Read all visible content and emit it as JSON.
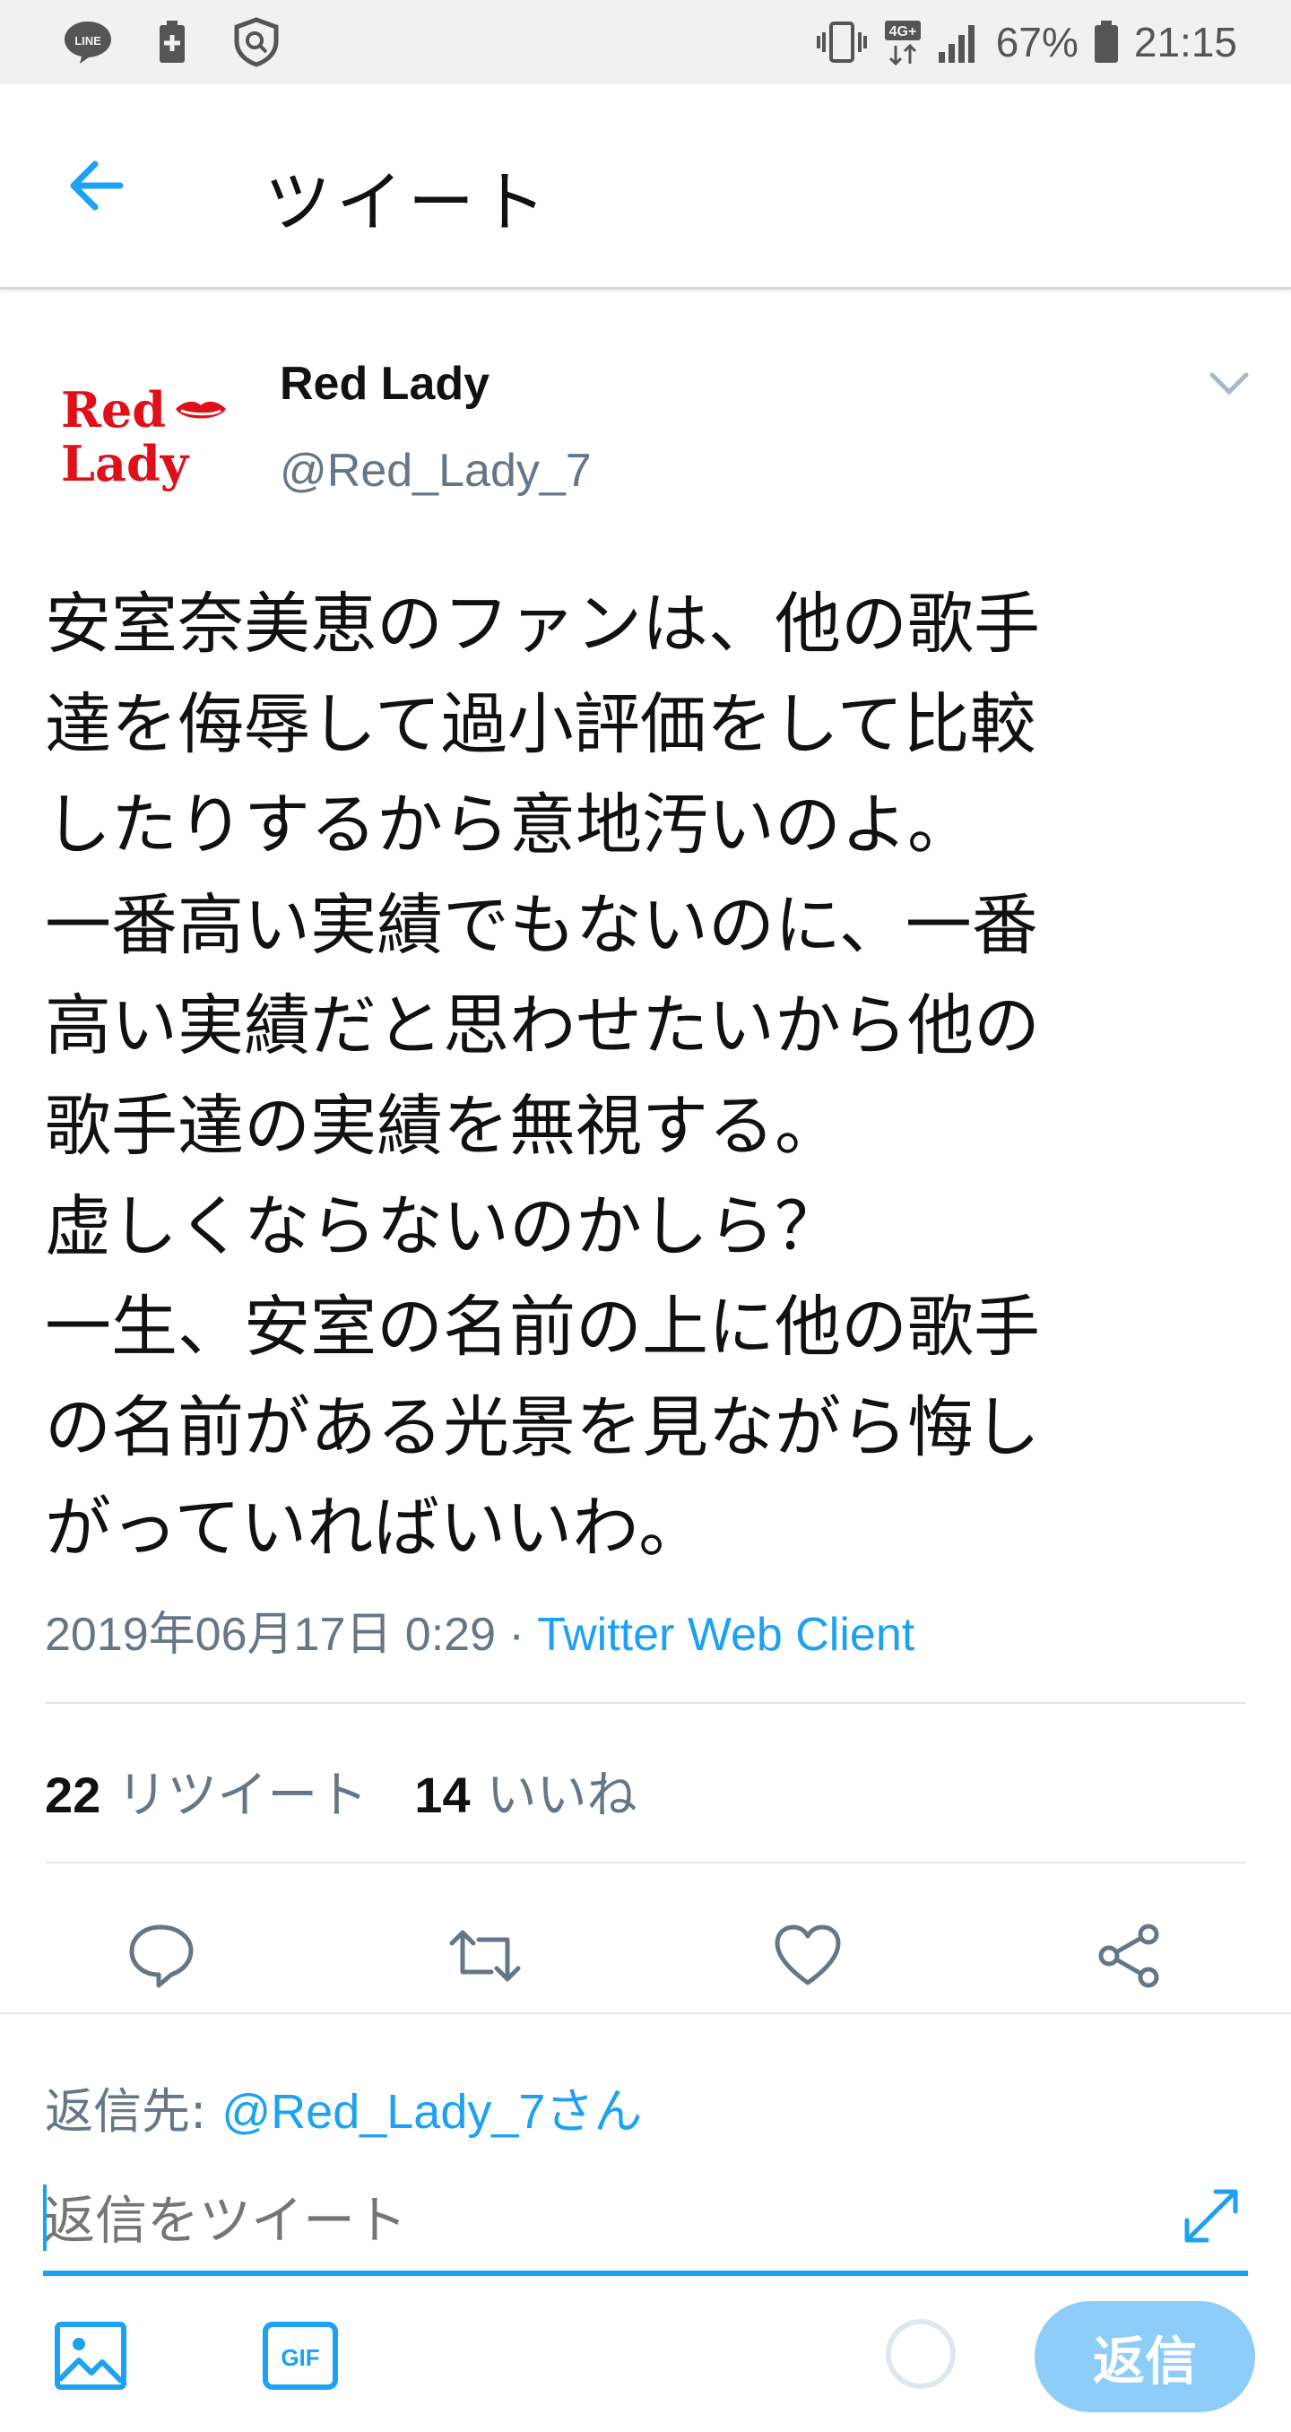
{
  "status_bar": {
    "line_icon": "LINE",
    "network": "4G+",
    "battery": "67%",
    "time": "21:15"
  },
  "header": {
    "title": "ツイート"
  },
  "tweet": {
    "author_name": "Red Lady",
    "author_handle": "@Red_Lady_7",
    "avatar_text_line1": "Red",
    "avatar_text_line2": "Lady",
    "text": "安室奈美恵のファンは、他の歌手\n達を侮辱して過小評価をして比較\nしたりするから意地汚いのよ。\n一番高い実績でもないのに、一番\n高い実績だと思わせたいから他の\n歌手達の実績を無視する。\n虚しくならないのかしら？\n一生、安室の名前の上に他の歌手\nの名前がある光景を見ながら悔し\nがっていればいいわ。",
    "date": "2019年06月17日 0:29",
    "separator": " · ",
    "client": "Twitter Web Client",
    "retweet_count": "22",
    "retweet_label": "リツイート",
    "like_count": "14",
    "like_label": "いいね"
  },
  "compose": {
    "reply_to_label": "返信先: ",
    "reply_to_handle": "@Red_Lady_7さん",
    "placeholder": "返信をツイート",
    "reply_button": "返信"
  },
  "colors": {
    "accent": "#1da1f2",
    "muted": "#657786",
    "avatar_red": "#e0101a"
  }
}
